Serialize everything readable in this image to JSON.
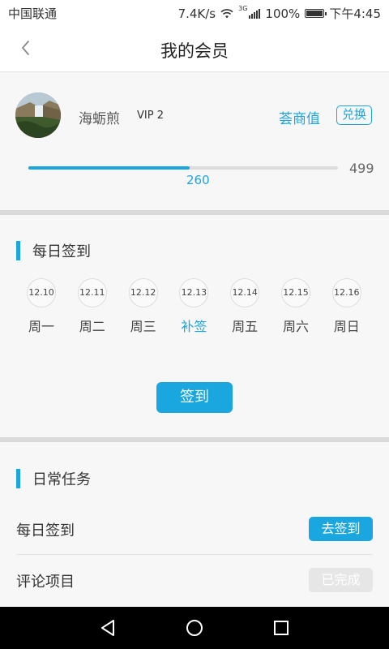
{
  "status_bar": {
    "carrier": "中国联通",
    "speed": "7.4K/s",
    "network": "3G",
    "battery": "100%",
    "battery_level": 1.0,
    "time": "下午4:45"
  },
  "nav": {
    "title": "我的会员",
    "back_icon": "chevron-left-icon"
  },
  "member": {
    "username": "海蛎煎",
    "vip_level": "VIP 2",
    "points_label": "荟商值",
    "exchange_label": "兑换",
    "progress_current": "260",
    "progress_max": "499",
    "progress_fraction": 0.521
  },
  "checkin": {
    "title": "每日签到",
    "days": [
      {
        "date": "12.10",
        "label": "周一",
        "highlight": false
      },
      {
        "date": "12.11",
        "label": "周二",
        "highlight": false
      },
      {
        "date": "12.12",
        "label": "周三",
        "highlight": false
      },
      {
        "date": "12.13",
        "label": "补签",
        "highlight": true
      },
      {
        "date": "12.14",
        "label": "周五",
        "highlight": false
      },
      {
        "date": "12.15",
        "label": "周六",
        "highlight": false
      },
      {
        "date": "12.16",
        "label": "周日",
        "highlight": false
      }
    ],
    "button_label": "签到"
  },
  "tasks": {
    "title": "日常任务",
    "items": [
      {
        "name": "每日签到",
        "action": "去签到",
        "state": "active"
      },
      {
        "name": "评论项目",
        "action": "已完成",
        "state": "done"
      }
    ]
  },
  "colors": {
    "accent": "#1aa6de",
    "done_button": "#e6e6e6"
  }
}
